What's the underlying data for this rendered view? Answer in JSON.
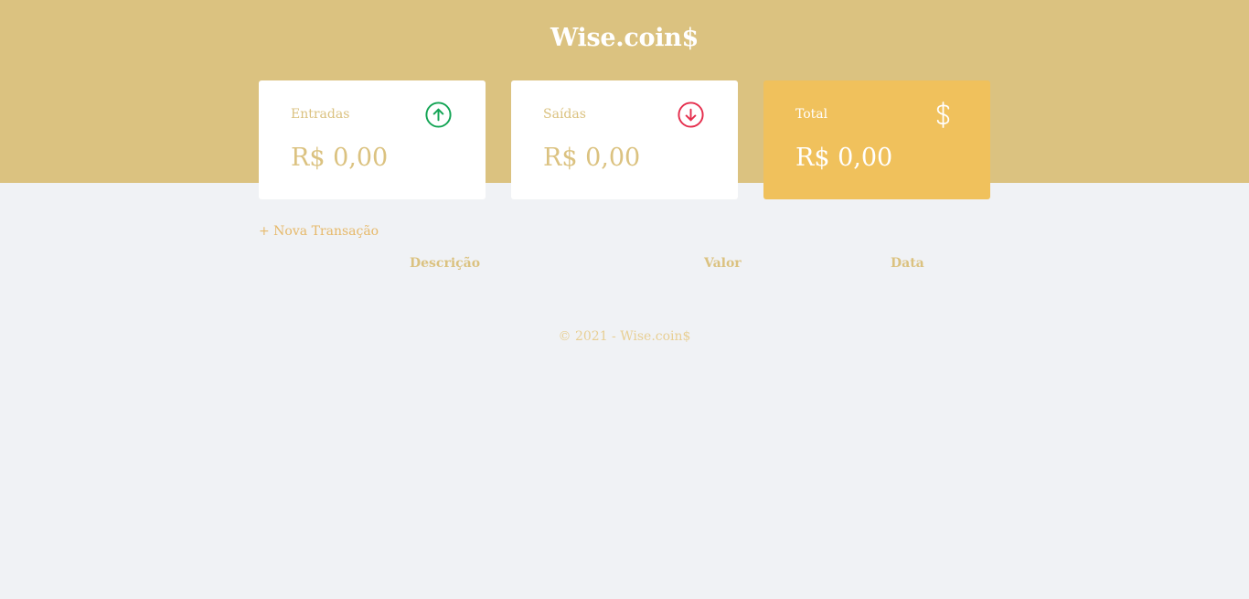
{
  "header": {
    "logo": "Wise.coin$"
  },
  "cards": {
    "income": {
      "label": "Entradas",
      "amount": "R$ 0,00",
      "icon": "arrow-up-circle-icon",
      "icon_color": "#12a454"
    },
    "expense": {
      "label": "Saídas",
      "amount": "R$ 0,00",
      "icon": "arrow-down-circle-icon",
      "icon_color": "#e52e4d"
    },
    "total": {
      "label": "Total",
      "amount": "R$ 0,00",
      "icon": "dollar-sign-icon"
    }
  },
  "transactions": {
    "new_label": "+ Nova Transação",
    "columns": [
      "Descrição",
      "Valor",
      "Data"
    ]
  },
  "footer": {
    "text": "© 2021 - Wise.coin$"
  },
  "colors": {
    "header_bg": "#dbc280",
    "total_card_bg": "#f0c15c",
    "page_bg": "#f0f2f5"
  }
}
